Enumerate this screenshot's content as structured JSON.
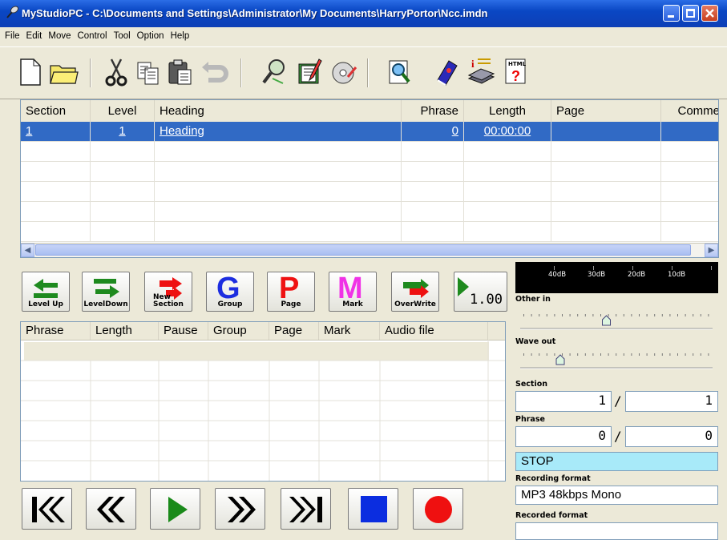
{
  "window": {
    "title": "MyStudioPC - C:\\Documents and Settings\\Administrator\\My Documents\\HarryPortor\\Ncc.imdn"
  },
  "menu": [
    "File",
    "Edit",
    "Move",
    "Control",
    "Tool",
    "Option",
    "Help"
  ],
  "toolbar": {
    "icons": [
      "new-file-icon",
      "open-folder-icon",
      "cut-icon",
      "copy-icon",
      "paste-icon",
      "undo-icon",
      "search-icon",
      "edit-book-icon",
      "cd-icon",
      "find-document-icon",
      "book-icon",
      "info-books-icon",
      "html-help-icon"
    ]
  },
  "section_table": {
    "headers": [
      "Section",
      "Level",
      "Heading",
      "Phrase",
      "Length",
      "Page",
      "Comme"
    ],
    "rows": [
      {
        "section": "1",
        "level": "1",
        "heading": "Heading",
        "phrase": "0",
        "length": "00:00:00",
        "page": "",
        "comment": ""
      }
    ]
  },
  "edit_buttons": {
    "level_up": "Level Up",
    "level_down": "LevelDown",
    "new_section": "New Section",
    "group": "Group",
    "page": "Page",
    "mark": "Mark",
    "overwrite": "OverWrite",
    "speed": "1.00"
  },
  "phrase_table": {
    "headers": [
      "Phrase",
      "Length",
      "Pause",
      "Group",
      "Page",
      "Mark",
      "Audio file"
    ]
  },
  "meter": {
    "labels": [
      "40dB",
      "30dB",
      "20dB",
      "10dB"
    ]
  },
  "panel": {
    "other_in_label": "Other in",
    "other_in_level": 0.45,
    "wave_out_label": "Wave out",
    "wave_out_level": 0.2,
    "section_label": "Section",
    "section_current": "1",
    "section_total": "1",
    "phrase_label": "Phrase",
    "phrase_current": "0",
    "phrase_total": "0",
    "slash": "/",
    "status": "STOP",
    "recording_format_label": "Recording format",
    "recording_format": "MP3 48kbps Mono",
    "recorded_format_label": "Recorded format",
    "recorded_format": ""
  },
  "colors": {
    "selection": "#316ac5",
    "status_bg": "#a8eaf9",
    "play_green": "#1a8a1a",
    "stop_blue": "#0b2de0",
    "record_red": "#ef1010"
  }
}
